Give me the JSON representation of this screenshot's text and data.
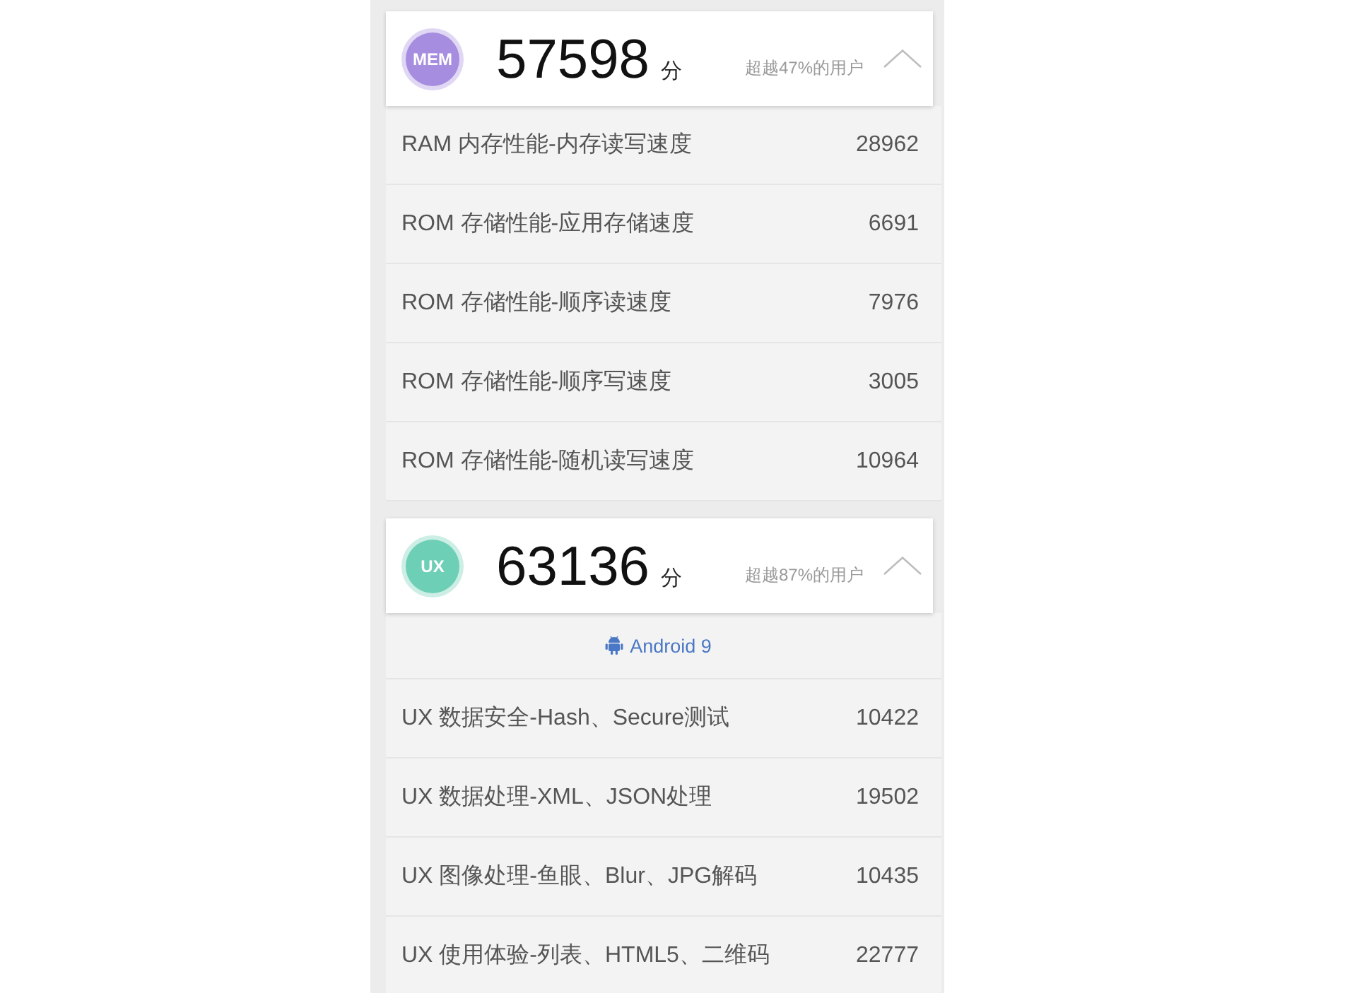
{
  "sections": [
    {
      "badge": "MEM",
      "color": "#a68ddf",
      "score": "57598",
      "unit": "分",
      "rank": "超越47%的用户",
      "expanded": true,
      "rows": [
        {
          "label": "RAM 内存性能-内存读写速度",
          "value": "28962"
        },
        {
          "label": "ROM 存储性能-应用存储速度",
          "value": "6691"
        },
        {
          "label": "ROM 存储性能-顺序读速度",
          "value": "7976"
        },
        {
          "label": "ROM 存储性能-顺序写速度",
          "value": "3005"
        },
        {
          "label": "ROM 存储性能-随机读写速度",
          "value": "10964"
        }
      ]
    },
    {
      "badge": "UX",
      "color": "#6dcfb6",
      "score": "63136",
      "unit": "分",
      "rank": "超越87%的用户",
      "expanded": true,
      "platform": "Android 9",
      "rows": [
        {
          "label": "UX 数据安全-Hash、Secure测试",
          "value": "10422"
        },
        {
          "label": "UX 数据处理-XML、JSON处理",
          "value": "19502"
        },
        {
          "label": "UX 图像处理-鱼眼、Blur、JPG解码",
          "value": "10435"
        },
        {
          "label": "UX 使用体验-列表、HTML5、二维码",
          "value": "22777"
        }
      ]
    }
  ]
}
